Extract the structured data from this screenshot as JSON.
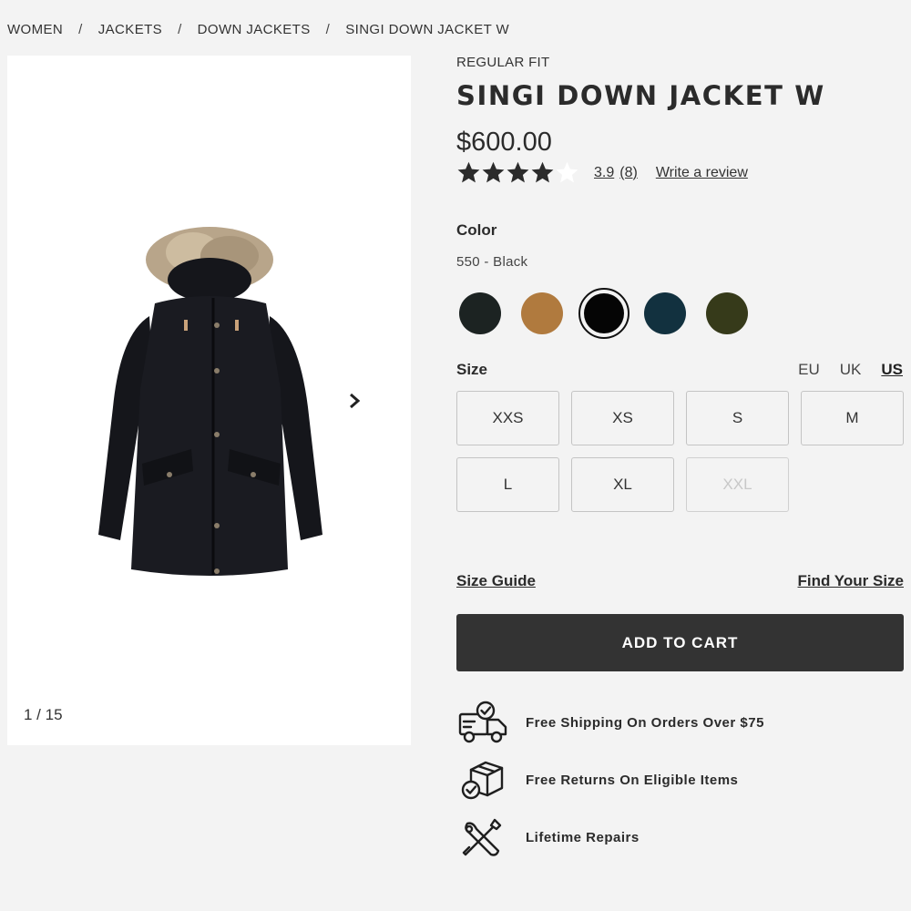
{
  "breadcrumb": [
    "WOMEN",
    "JACKETS",
    "DOWN JACKETS",
    "SINGI DOWN JACKET W"
  ],
  "breadcrumb_separator": "/",
  "gallery": {
    "counter": "1 / 15",
    "image_icon": "jacket-image"
  },
  "product": {
    "fit": "REGULAR FIT",
    "title": "SINGI DOWN JACKET W",
    "price": "$600.00",
    "rating": {
      "stars_filled": 4,
      "stars_total": 5,
      "score": "3.9",
      "count": "(8)",
      "write_review": "Write a review"
    }
  },
  "color": {
    "label": "Color",
    "selected_value": "550 - Black",
    "swatches": [
      {
        "hex": "#1c2322",
        "selected": false
      },
      {
        "hex": "#b07a3e",
        "selected": false
      },
      {
        "hex": "#050505",
        "selected": true
      },
      {
        "hex": "#12313f",
        "selected": false
      },
      {
        "hex": "#363a1a",
        "selected": false
      }
    ]
  },
  "size": {
    "label": "Size",
    "systems": [
      {
        "label": "EU",
        "active": false
      },
      {
        "label": "UK",
        "active": false
      },
      {
        "label": "US",
        "active": true
      }
    ],
    "options": [
      {
        "label": "XXS",
        "available": true
      },
      {
        "label": "XS",
        "available": true
      },
      {
        "label": "S",
        "available": true
      },
      {
        "label": "M",
        "available": true
      },
      {
        "label": "L",
        "available": true
      },
      {
        "label": "XL",
        "available": true
      },
      {
        "label": "XXL",
        "available": false
      }
    ],
    "guide_link": "Size Guide",
    "find_link": "Find Your Size"
  },
  "cart": {
    "button_label": "ADD TO CART"
  },
  "perks": [
    {
      "icon": "delivery-truck-icon",
      "text": "Free Shipping On Orders Over $75"
    },
    {
      "icon": "return-box-icon",
      "text": "Free Returns On Eligible Items"
    },
    {
      "icon": "repair-tools-icon",
      "text": "Lifetime Repairs"
    }
  ],
  "colors": {
    "accent": "#333333",
    "page_bg": "#f3f3f3",
    "text": "#2b2b2b"
  }
}
